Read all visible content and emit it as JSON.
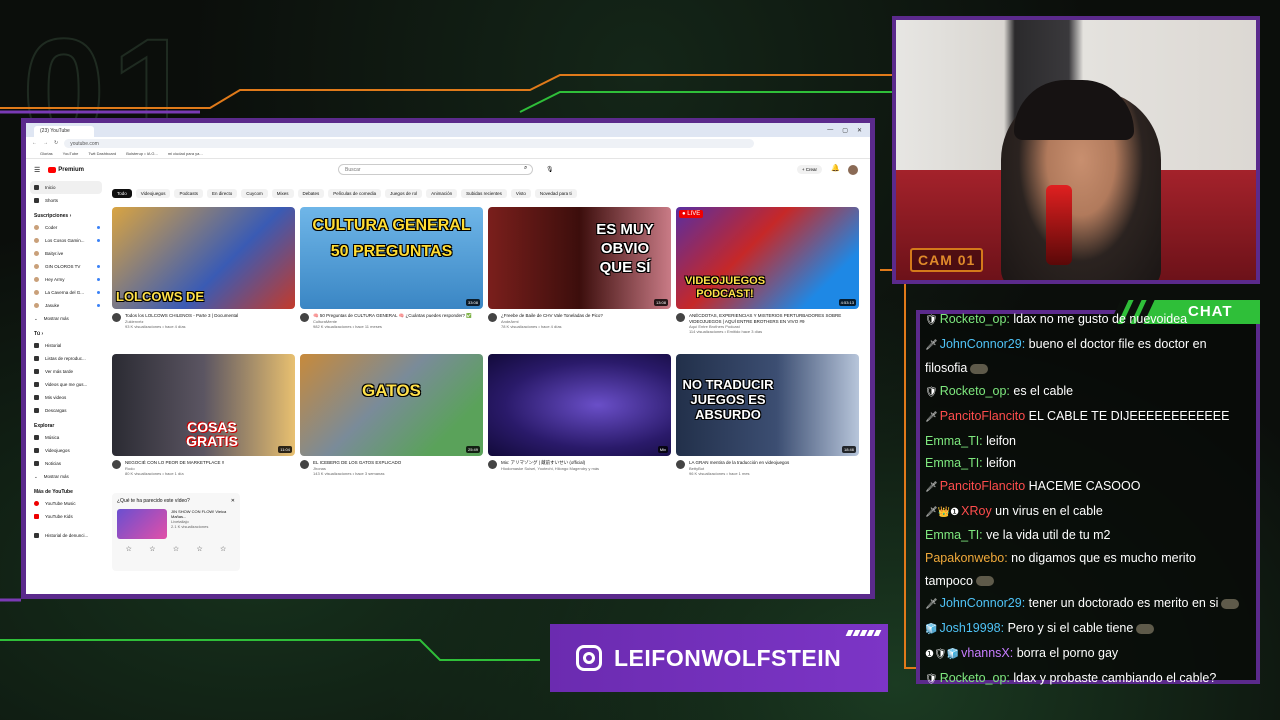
{
  "overlay": {
    "bg_number": "01",
    "cam_label": "CAM 01",
    "chat_title": "CHAT",
    "instagram_handle": "LEIFONWOLFSTEIN"
  },
  "browser": {
    "tab_title": "(23) YouTube",
    "url": "youtube.com",
    "bookmarks": [
      "Glorias",
      "YouTube",
      "Twit Dashboard",
      "Bolsterup • IA G...",
      "mi ciudad para ya..."
    ],
    "window_controls": [
      "—",
      "▢",
      "✕"
    ]
  },
  "youtube": {
    "logo": "Premium",
    "search_placeholder": "Buscar",
    "create_label": "+ Crear",
    "chips": [
      "Todo",
      "Videojuegos",
      "Podcasts",
      "En directo",
      "Cuycom",
      "Mixes",
      "Debates",
      "Películas de comedia",
      "Juegos de rol",
      "Animación",
      "Subidas recientes",
      "Visto",
      "Novedad para ti"
    ],
    "sidebar": {
      "main": [
        "Inicio",
        "Shorts"
      ],
      "subs_header": "Suscripciones ›",
      "subs": [
        "Coder",
        "Los Cosos Gamin...",
        "Baityr.ive",
        "GIN OLOROS TV",
        "Hey Army",
        "La Caverna del G...",
        "Jasuke",
        "Mostrar más"
      ],
      "you_header": "Tú ›",
      "you": [
        "Historial",
        "Listas de reproduc...",
        "Ver más tarde",
        "Videos que me gus...",
        "Mis videos",
        "Descargas"
      ],
      "explore_header": "Explorar",
      "explore": [
        "Música",
        "Videojuegos",
        "Noticias",
        "Mostrar más"
      ],
      "more_header": "Más de YouTube",
      "more": [
        "YouTube Music",
        "YouTube Kids"
      ],
      "footer": "Historial de denunci..."
    },
    "videos": [
      {
        "thumb_text": "LOLCOWS DE",
        "duration": "",
        "title": "Todos los LOLCOWS CHILENOS - Parte 3 | Documental",
        "channel": "Zuklenvrtz",
        "stats": "93 K visualizaciones • hace 4 días"
      },
      {
        "thumb_text": "CULTURA GENERAL 50 PREGUNTAS",
        "duration": "33:08",
        "title": "🧠 50 Preguntas de CULTURA GENERAL 🧠 ¿Cuántas puedes responder? ✅",
        "channel": "CulturaMente",
        "stats": "982 K visualizaciones • hace 11 meses"
      },
      {
        "thumb_text": "ES MUY OBVIO QUE SÍ",
        "duration": "13:08",
        "title": "¿Freebe de Baile de CHV Vale Toneladas de Pico?",
        "channel": "AndeArmi",
        "stats": "78 K visualizaciones • hace 4 días"
      },
      {
        "thumb_text": "VIDEOJUEGOS PODCAST!",
        "duration": "4:53:13",
        "title": "ANÉCDOTAS, EXPERIENCIAS Y MISTERIOS PERTURBADORES SOBRE VIDEOJUEGOS | AQUÍ ENTRE BROTHERS EN VIVO #9",
        "channel": "Aquí Entre Brothers Podcast",
        "stats": "114 visualizaciones • Emitido hace 3 días"
      },
      {
        "thumb_text": "COSAS GRATIS",
        "duration": "11:04",
        "title": "NEGOCIÉ CON LO PEOR DE MARKETPLACE ‼",
        "channel": "Rodo",
        "stats": "80 K visualizaciones • hace 1 día"
      },
      {
        "thumb_text": "GATOS",
        "duration": "25:49",
        "title": "EL ICEBERG DE LOS GATOS EXPLICADO",
        "channel": "Jhonas",
        "stats": "143 K visualizaciones • hace 3 semanas"
      },
      {
        "thumb_text": "",
        "duration": "Mix",
        "title": "Mix: アリマゾング | 蔵前すいせい (official)",
        "channel": "Hiodomaske Suisei, Yootechi, Hilongo Magendry y más",
        "stats": ""
      },
      {
        "thumb_text": "NO TRADUCIR JUEGOS ES ABSURDO",
        "duration": "18:46",
        "title": "LA GRAN mentira de la traducción en videojuegos",
        "channel": "BettyBot",
        "stats": "96 K visualizaciones • hace 1 mes"
      }
    ],
    "survey": {
      "question": "¿Qué te ha parecido este vídeo?",
      "video_title": "JIN SHOW CON FLOW! Vieica Mañas...",
      "channel": "Livetallajo",
      "stats": "2.1 K visualizaciones"
    }
  },
  "chat": [
    {
      "user": "Rocketo_op:",
      "color": "#7ee87e",
      "badge": "🛡",
      "text": " ldax no me gusto de nuevoidea"
    },
    {
      "user": "JohnConnor29:",
      "color": "#4fc3f7",
      "badge": "🗡",
      "text": " bueno el doctor file es doctor en filosofia",
      "emote": true
    },
    {
      "user": "Rocketo_op:",
      "color": "#7ee87e",
      "badge": "🛡",
      "text": " es el cable"
    },
    {
      "user": "PancitoFlancito",
      "color": "#ff4d4d",
      "badge": "🗡",
      "text": " EL CABLE TE DIJEEEEEEEEEEEE"
    },
    {
      "user": "Emma_TI:",
      "color": "#7ee87e",
      "badge": "",
      "text": " leifon"
    },
    {
      "user": "Emma_TI:",
      "color": "#7ee87e",
      "badge": "",
      "text": " leifon"
    },
    {
      "user": "PancitoFlancito",
      "color": "#ff4d4d",
      "badge": "🗡",
      "text": " HACEME CASOOO"
    },
    {
      "user": "XRoy",
      "color": "#ff4d4d",
      "badge": "🗡👑❶",
      "text": " un virus en el cable"
    },
    {
      "user": "Emma_TI:",
      "color": "#7ee87e",
      "badge": "",
      "text": " ve la vida util de tu m2"
    },
    {
      "user": "Papakonwebo:",
      "color": "#f0a93b",
      "badge": "",
      "text": " no digamos que es mucho merito tampoco",
      "emote": true
    },
    {
      "user": "JohnConnor29:",
      "color": "#4fc3f7",
      "badge": "🗡",
      "text": " tener un doctorado es merito en si",
      "emote": true
    },
    {
      "user": "Josh19998:",
      "color": "#4fc3f7",
      "badge": "🧊",
      "text": " Pero y si el cable tiene",
      "emote": true
    },
    {
      "user": "vhannsX:",
      "color": "#c77dff",
      "badge": "❶🛡🧊",
      "text": " borra el porno gay"
    },
    {
      "user": "Rocketo_op:",
      "color": "#7ee87e",
      "badge": "🛡",
      "text": " ldax y probaste cambiando el cable?"
    }
  ]
}
